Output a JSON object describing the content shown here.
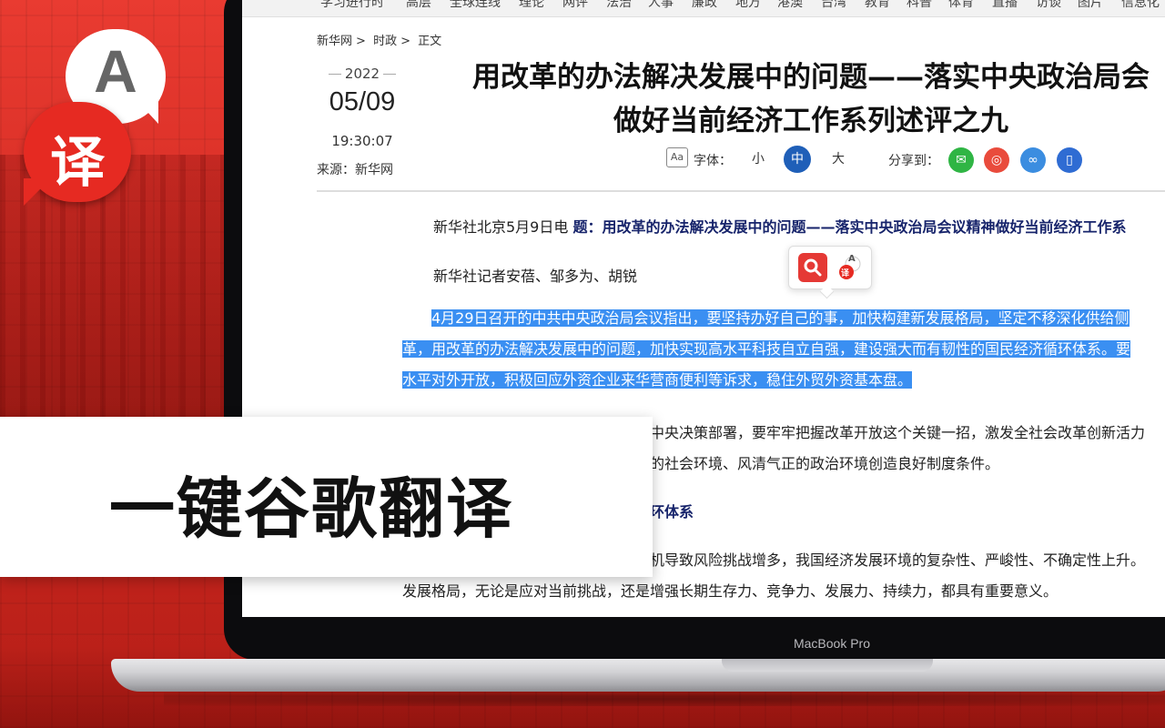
{
  "nav_items": [
    "学习进行时",
    "高层",
    "全球连线",
    "理论",
    "网评",
    "法治",
    "人事",
    "廉政",
    "地方",
    "港澳",
    "台湾",
    "教育",
    "科普",
    "体育",
    "直播",
    "访谈",
    "图片",
    "信息化"
  ],
  "breadcrumb": {
    "site": "新华网",
    "sep1": ">",
    "section": "时政",
    "sep2": ">",
    "current": "正文"
  },
  "date": {
    "year": "2022",
    "day": "05/09",
    "time": "19:30:07",
    "source": "来源：新华网"
  },
  "article": {
    "title_line1": "用改革的办法解决发展中的问题——落实中央政治局会",
    "title_line2": "做好当前经济工作系列述评之九",
    "font_label": "字体：",
    "font_small": "小",
    "font_medium": "中",
    "font_large": "大",
    "share_label": "分享到：",
    "lead_prefix": "新华社北京5月9日电 ",
    "lead_bold": "题：用改革的办法解决发展中的问题——落实中央政治局会议精神做好当前经济工作系",
    "reporters": "新华社记者安蓓、邹多为、胡锐",
    "sel_line1": "4月29日召开的中共中央政治局会议指出，要坚持办好自己的事，加快构建新发展格局，坚定不移深化供给侧",
    "sel_line2": "革，用改革的办法解决发展中的问题，加快实现高水平科技自立自强，建设强大而有韧性的国民经济循环体系。要",
    "sel_line3": "水平对外开放，积极回应外资企业来华营商便利等诉求，稳住外贸外资基本盘。",
    "para2_line1": "中央决策部署，要牢牢把握改革开放这个关键一招，激发全社会改革创新活力",
    "para2_line2": "的社会环境、风清气正的政治环境创造良好制度条件。",
    "heading_fragment": "环体系",
    "para3_line1": "机导致风险挑战增多，我国经济发展环境的复杂性、严峻性、不确定性上升。",
    "para3_line2": "发展格局，无论是应对当前挑战，还是增强长期生存力、竞争力、发展力、持续力，都具有重要意义。"
  },
  "popup": {
    "trans_letter": "A",
    "trans_char": "译"
  },
  "device_label": "MacBook Pro",
  "banner_text": "一键谷歌翻译",
  "logo": {
    "letter": "A",
    "char": "译"
  },
  "colors": {
    "brand_red": "#e62a22",
    "highlight": "#3a8ff2",
    "active_font": "#1f5fb8",
    "heading_navy": "#17246b"
  },
  "share_icons": [
    "wechat-icon",
    "weibo-icon",
    "link-icon",
    "mobile-icon"
  ]
}
